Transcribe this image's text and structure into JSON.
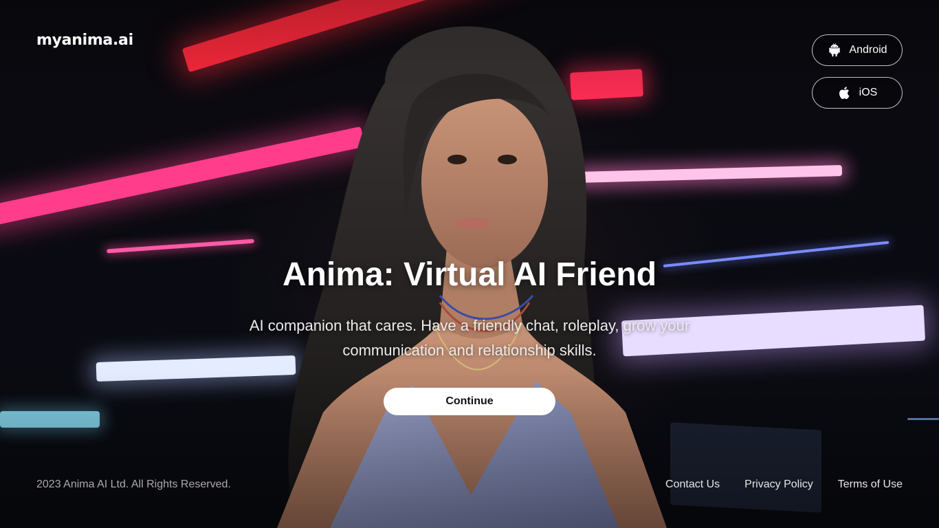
{
  "brand": {
    "logo_text": "myanima.ai"
  },
  "store_buttons": {
    "android": {
      "label": "Android",
      "icon": "android-icon"
    },
    "ios": {
      "label": "iOS",
      "icon": "apple-icon"
    }
  },
  "hero": {
    "title": "Anima: Virtual AI Friend",
    "subtitle": "AI companion that cares. Have a friendly chat, roleplay, grow your communication and relationship skills.",
    "cta_label": "Continue"
  },
  "footer": {
    "copyright": "2023 Anima AI Ltd. All Rights Reserved.",
    "links": [
      "Contact Us",
      "Privacy Policy",
      "Terms of Use"
    ]
  },
  "colors": {
    "background": "#07070b",
    "text": "#ffffff",
    "cta_background": "#ffffff",
    "cta_text": "#111111",
    "muted_text": "#a9a9ae"
  }
}
